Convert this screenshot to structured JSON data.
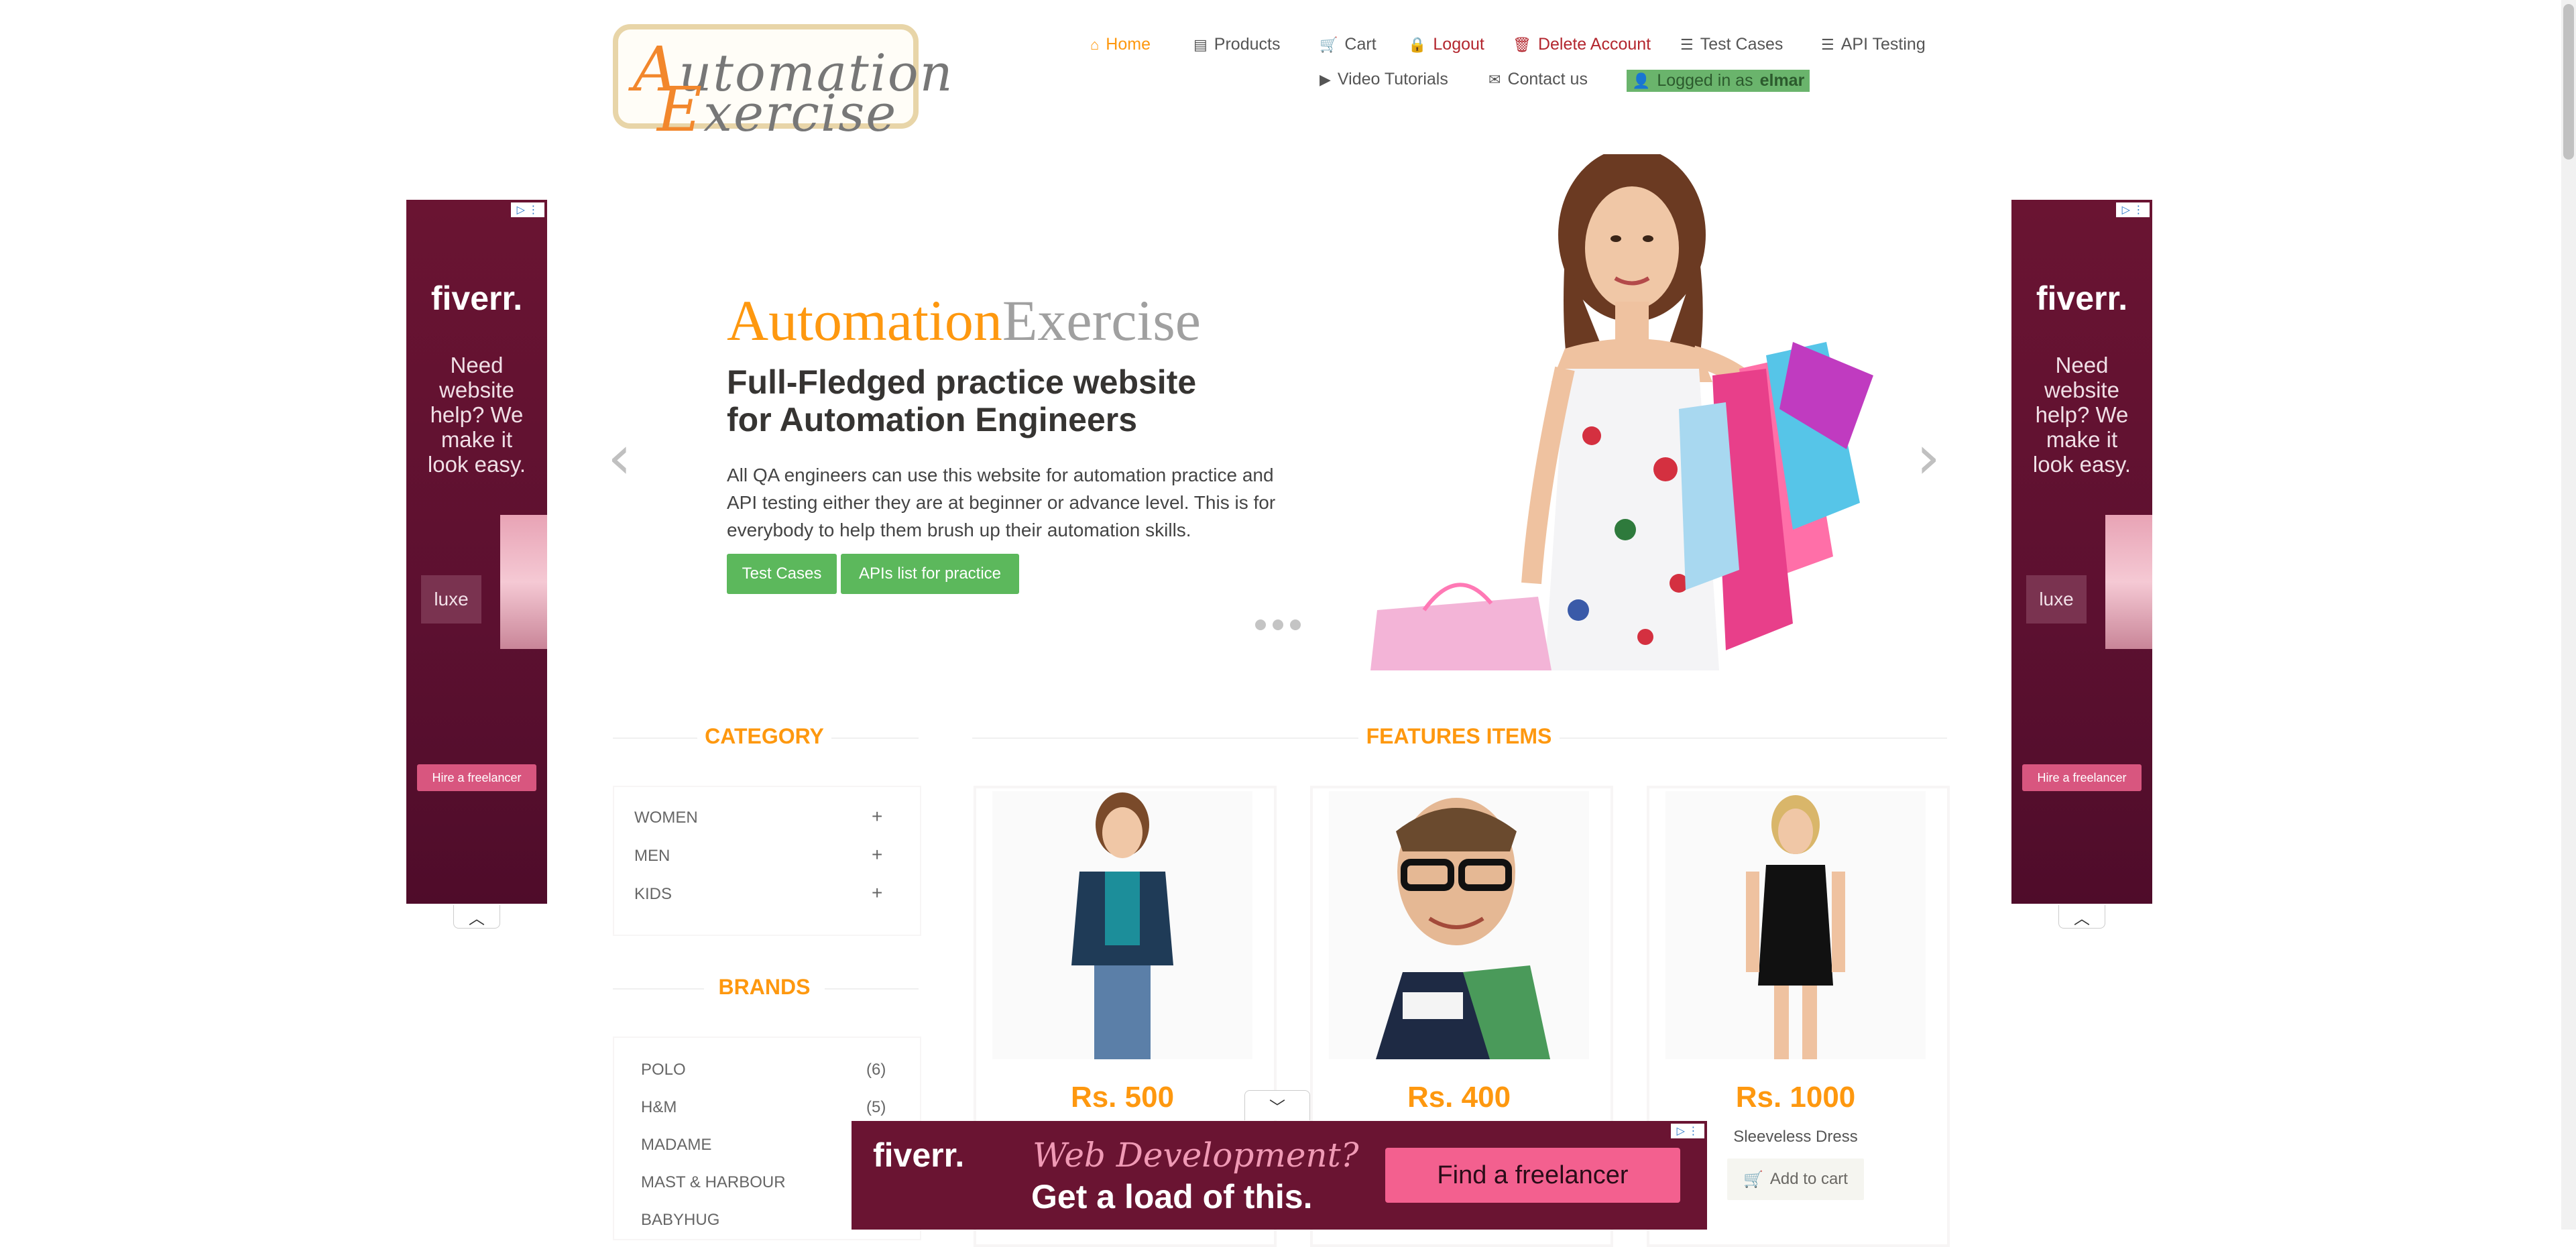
{
  "header": {
    "logo_text_line1": "Automation",
    "logo_text_line2": "Exercise",
    "nav": [
      {
        "label": "Home",
        "icon": "home-icon"
      },
      {
        "label": "Products",
        "icon": "products-icon"
      },
      {
        "label": "Cart",
        "icon": "cart-icon"
      },
      {
        "label": "Logout",
        "icon": "lock-icon"
      },
      {
        "label": "Delete Account",
        "icon": "trash-icon"
      },
      {
        "label": "Test Cases",
        "icon": "list-icon"
      },
      {
        "label": "API Testing",
        "icon": "list-icon"
      },
      {
        "label": "Video Tutorials",
        "icon": "youtube-icon"
      },
      {
        "label": "Contact us",
        "icon": "envelope-icon"
      }
    ],
    "logged_in_prefix": "Logged in as",
    "logged_in_user": "elmar"
  },
  "slider": {
    "brand_a": "Automation",
    "brand_b": "Exercise",
    "headline": "Full-Fledged practice website for Automation Engineers",
    "description": "All QA engineers can use this website for automation practice and API testing either they are at beginner or advance level. This is for everybody to help them brush up their automation skills.",
    "btn_test_cases": "Test Cases",
    "btn_apis": "APIs list for practice",
    "prev": "‹",
    "next": "›"
  },
  "left_ad": {
    "brand": "fiverr.",
    "message": "Need website help? We make it look easy.",
    "luxe": "luxe",
    "hire": "Hire a freelancer"
  },
  "right_ad": {
    "brand": "fiverr.",
    "message": "Need website help? We make it look easy.",
    "luxe": "luxe",
    "hire": "Hire a freelancer"
  },
  "sidebar": {
    "category_title": "CATEGORY",
    "categories": [
      "WOMEN",
      "MEN",
      "KIDS"
    ],
    "brands_title": "BRANDS",
    "brands": [
      {
        "name": "POLO",
        "count": "(6)"
      },
      {
        "name": "H&M",
        "count": "(5)"
      },
      {
        "name": "MADAME",
        "count": ""
      },
      {
        "name": "MAST & HARBOUR",
        "count": ""
      },
      {
        "name": "BABYHUG",
        "count": ""
      }
    ]
  },
  "features": {
    "title": "FEATURES ITEMS",
    "products": [
      {
        "price": "Rs. 500",
        "name": ""
      },
      {
        "price": "Rs. 400",
        "name": ""
      },
      {
        "price": "Rs. 1000",
        "name": "Sleeveless Dress",
        "cta": "Add to cart"
      }
    ]
  },
  "bottom_ad": {
    "brand": "fiverr.",
    "line1": "Web Development?",
    "line2": "Get a load of this.",
    "cta": "Find a freelancer"
  },
  "colors": {
    "accent": "#fe980f",
    "green": "#5cb85c",
    "ad_bg": "#6a1432"
  }
}
